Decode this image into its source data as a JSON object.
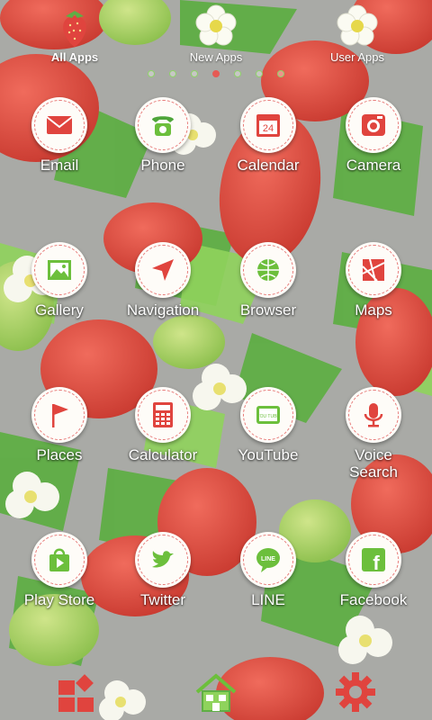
{
  "tabs": [
    {
      "label": "All Apps",
      "icon": "strawberry-icon",
      "active": true
    },
    {
      "label": "New Apps",
      "icon": "flower-icon",
      "active": false
    },
    {
      "label": "User Apps",
      "icon": "flower-icon",
      "active": false
    }
  ],
  "page_indicator": {
    "count": 7,
    "active_index": 3
  },
  "apps": [
    {
      "label": "Email",
      "icon": "envelope-icon"
    },
    {
      "label": "Phone",
      "icon": "phone-icon"
    },
    {
      "label": "Calendar",
      "icon": "calendar-icon",
      "icon_text": "24"
    },
    {
      "label": "Camera",
      "icon": "camera-icon"
    },
    {
      "label": "Gallery",
      "icon": "picture-icon"
    },
    {
      "label": "Navigation",
      "icon": "navigation-arrow-icon"
    },
    {
      "label": "Browser",
      "icon": "globe-icon"
    },
    {
      "label": "Maps",
      "icon": "map-icon"
    },
    {
      "label": "Places",
      "icon": "flag-icon"
    },
    {
      "label": "Calculator",
      "icon": "calculator-icon"
    },
    {
      "label": "YouTube",
      "icon": "tv-icon",
      "icon_text": "YOU TUBE"
    },
    {
      "label": "Voice\nSearch",
      "icon": "microphone-icon"
    },
    {
      "label": "Play Store",
      "icon": "shopping-bag-icon"
    },
    {
      "label": "Twitter",
      "icon": "bird-icon"
    },
    {
      "label": "LINE",
      "icon": "chat-bubble-icon",
      "icon_text": "LINE"
    },
    {
      "label": "Facebook",
      "icon": "facebook-icon",
      "icon_text": "f"
    }
  ],
  "dock": [
    {
      "icon": "app-grid-icon"
    },
    {
      "icon": "home-icon"
    },
    {
      "icon": "gear-icon"
    }
  ],
  "colors": {
    "accent_red": "#e0443e",
    "accent_green": "#6cbf3c",
    "label_white": "#ffffff",
    "background_gray": "#a9aaa6"
  }
}
